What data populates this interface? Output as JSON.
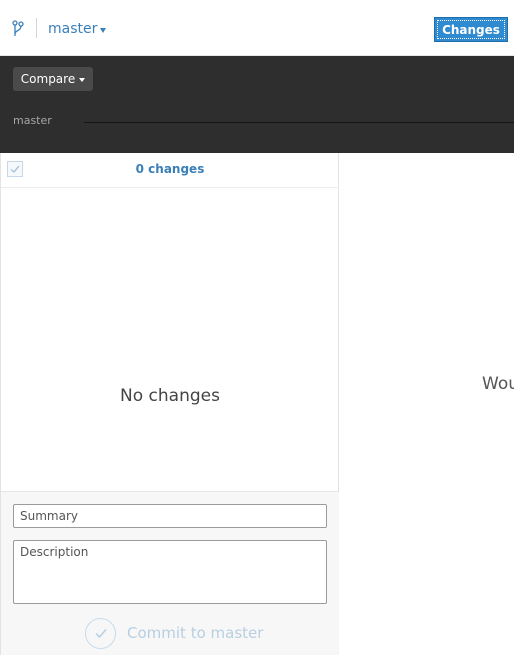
{
  "header": {
    "branch_icon": "git-branch-icon",
    "branch_name": "master",
    "branch_caret_icon": "caret-down-icon",
    "changes_tab_label": "Changes",
    "accent_color": "#2f8ad0",
    "link_color": "#3a7fb8"
  },
  "compare": {
    "button_label": "Compare",
    "caret_icon": "caret-down-icon",
    "timeline_label": "master",
    "band_color": "#2e2e2e"
  },
  "changes_panel": {
    "checkbox_icon": "checkmark-icon",
    "count_label": "0 changes",
    "empty_message": "No changes"
  },
  "commit": {
    "summary_placeholder": "Summary",
    "description_placeholder": "Description",
    "commit_icon": "checkmark-circle-icon",
    "commit_label": "Commit to master"
  },
  "detail_panel": {
    "message": "Wou"
  }
}
